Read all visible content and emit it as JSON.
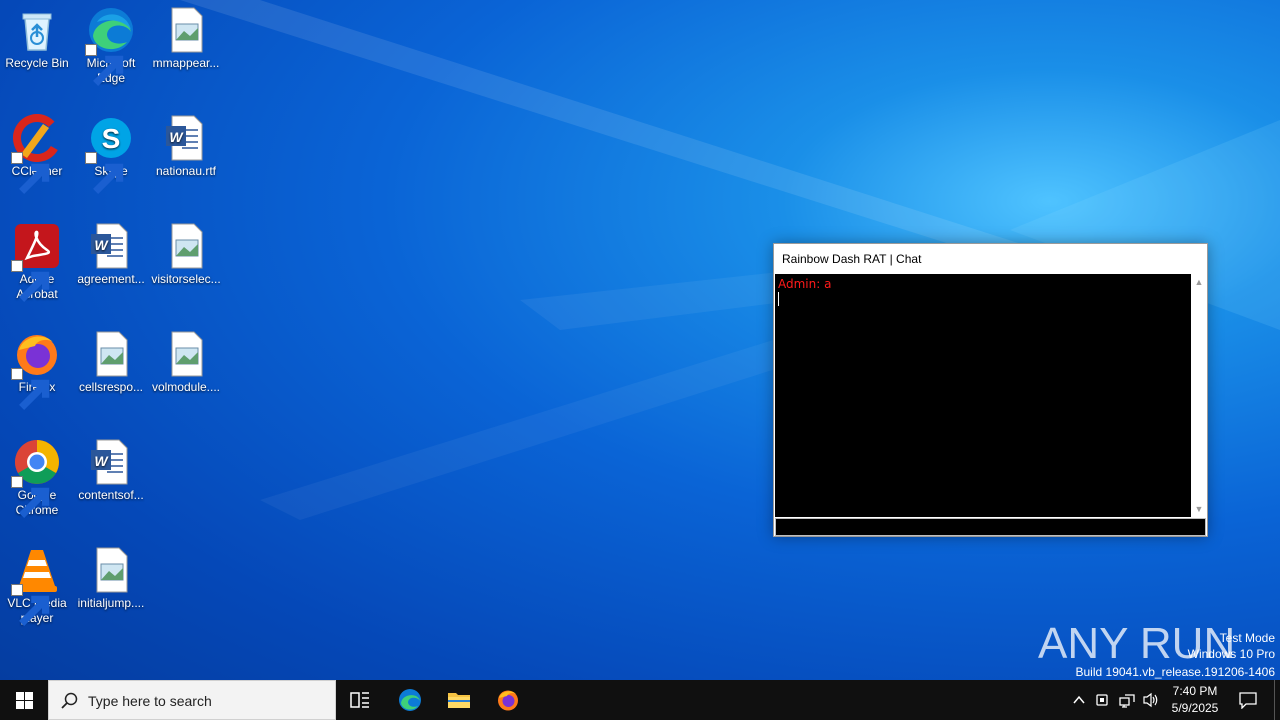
{
  "desktop": {
    "icons": [
      {
        "label": "Recycle Bin"
      },
      {
        "label": "Microsoft Edge"
      },
      {
        "label": "mmappear..."
      },
      {
        "label": "CCleaner"
      },
      {
        "label": "Skype"
      },
      {
        "label": "nationau.rtf"
      },
      {
        "label": "Adobe Acrobat"
      },
      {
        "label": "agreement..."
      },
      {
        "label": "visitorselec..."
      },
      {
        "label": "Firefox"
      },
      {
        "label": "cellsrespo..."
      },
      {
        "label": "volmodule...."
      },
      {
        "label": "Google Chrome"
      },
      {
        "label": "contentsof..."
      },
      {
        "label": "VLC media player"
      },
      {
        "label": "initialjump...."
      }
    ]
  },
  "chat_window": {
    "title": "Rainbow Dash RAT | Chat",
    "messages": [
      "Admin: a"
    ],
    "input_value": "",
    "message_color": "#ff1a1a"
  },
  "watermark": {
    "brand": "ANY RUN",
    "line1": "Test Mode",
    "line2": "Windows 10 Pro",
    "line3": "Build 19041.vb_release.191206-1406"
  },
  "taskbar": {
    "search_placeholder": "Type here to search",
    "time": "7:40 PM",
    "date": "5/9/2025"
  }
}
